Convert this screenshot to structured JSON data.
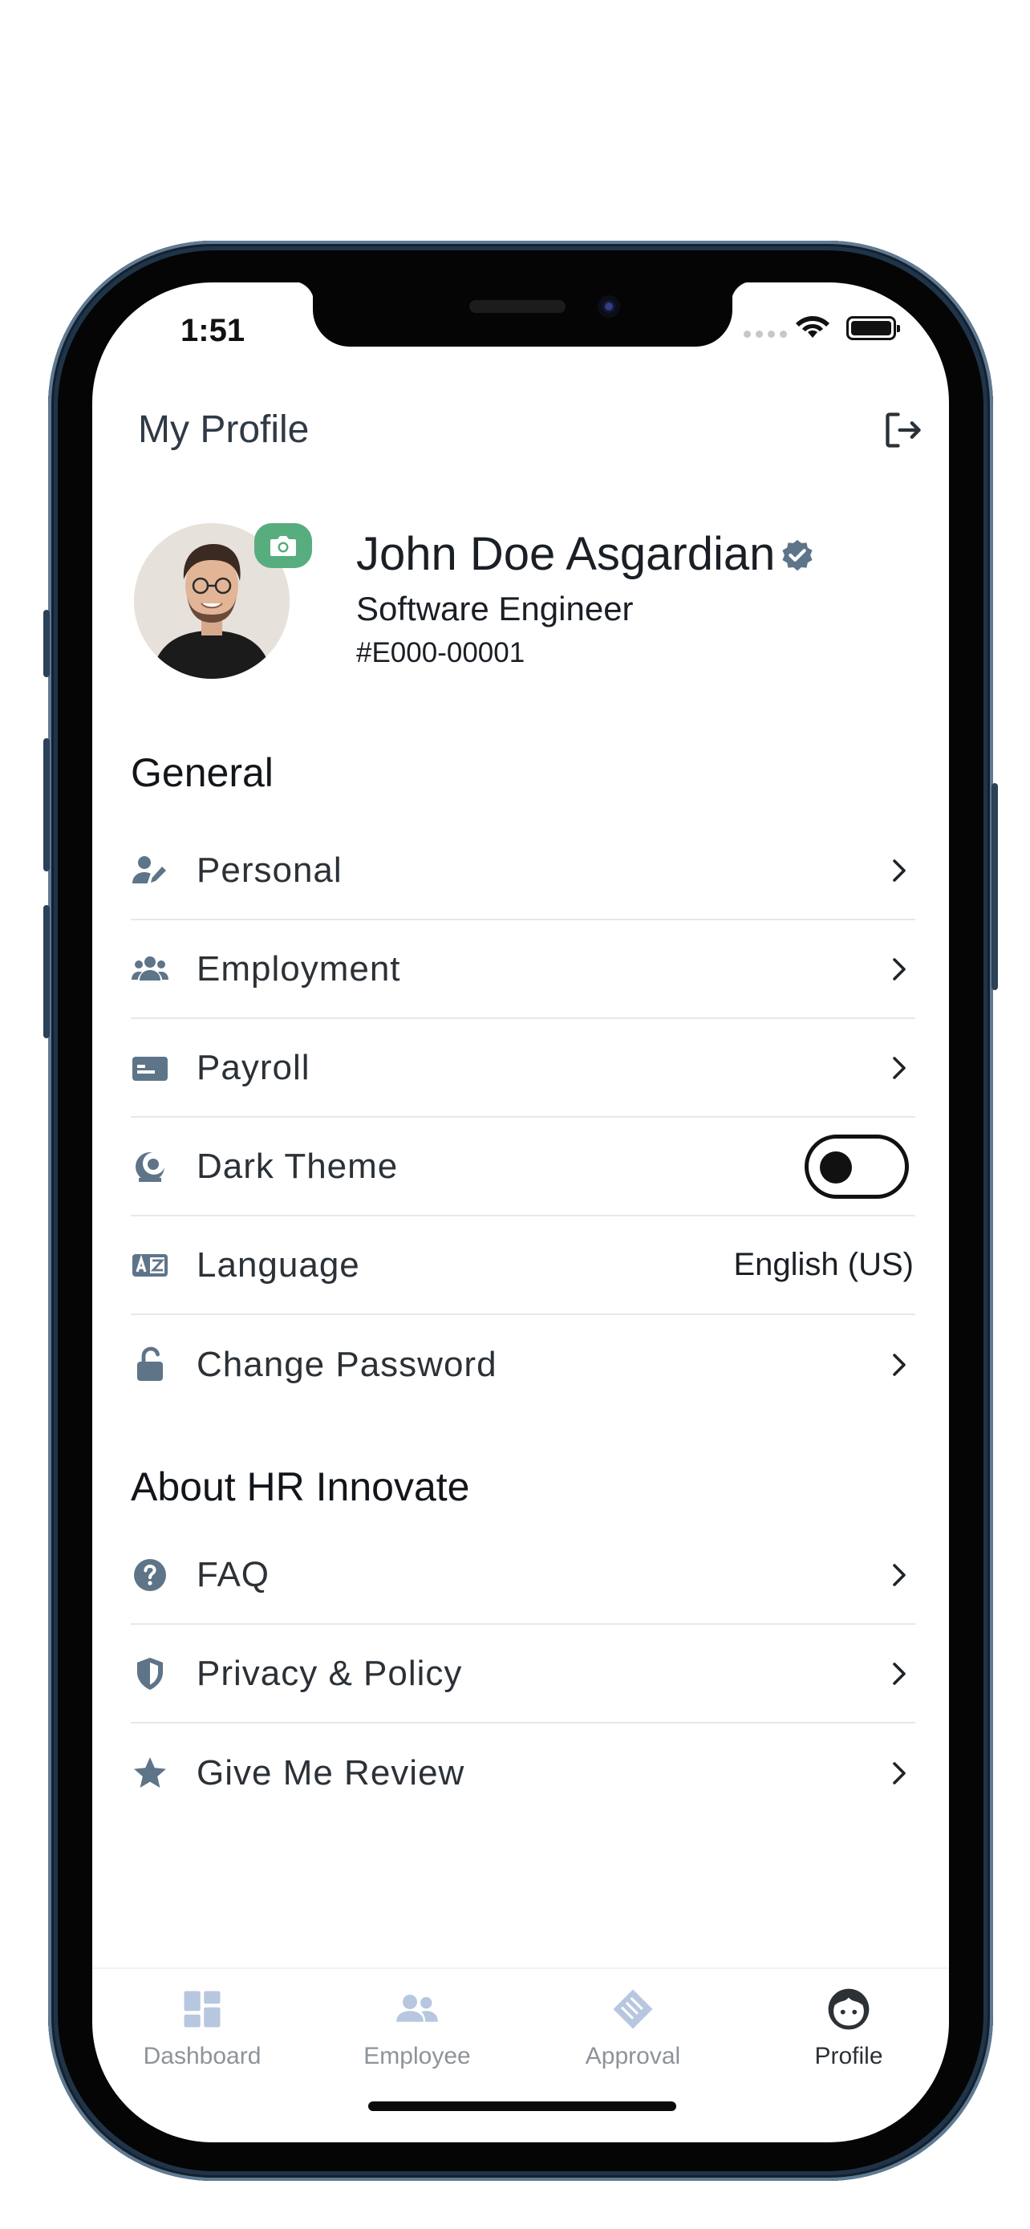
{
  "status_bar": {
    "time": "1:51"
  },
  "header": {
    "title": "My Profile"
  },
  "profile": {
    "name": "John Doe Asgardian",
    "role": "Software Engineer",
    "employee_id": "#E000-00001"
  },
  "sections": {
    "general": {
      "title": "General",
      "items": [
        {
          "label": "Personal",
          "icon": "user-edit-icon"
        },
        {
          "label": "Employment",
          "icon": "users-icon"
        },
        {
          "label": "Payroll",
          "icon": "payroll-card-icon"
        },
        {
          "label": "Dark Theme",
          "icon": "theme-icon",
          "toggle": false
        },
        {
          "label": "Language",
          "icon": "language-icon",
          "value": "English (US)"
        },
        {
          "label": "Change Password",
          "icon": "unlock-icon"
        }
      ]
    },
    "about": {
      "title": "About HR Innovate",
      "items": [
        {
          "label": "FAQ",
          "icon": "help-icon"
        },
        {
          "label": "Privacy & Policy",
          "icon": "shield-icon"
        },
        {
          "label": "Give Me Review",
          "icon": "star-icon"
        }
      ]
    }
  },
  "bottom_nav": {
    "items": [
      {
        "label": "Dashboard",
        "icon": "dashboard-icon",
        "active": false
      },
      {
        "label": "Employee",
        "icon": "employee-icon",
        "active": false
      },
      {
        "label": "Approval",
        "icon": "approval-icon",
        "active": false
      },
      {
        "label": "Profile",
        "icon": "profile-icon",
        "active": true
      }
    ]
  },
  "colors": {
    "icon": "#5e7488",
    "accent_green": "#58ad7f",
    "nav_inactive_icon": "#b7c7e0",
    "text_dark": "#1a1f26",
    "divider": "#e6e8ea",
    "frame": "#1f3449"
  }
}
